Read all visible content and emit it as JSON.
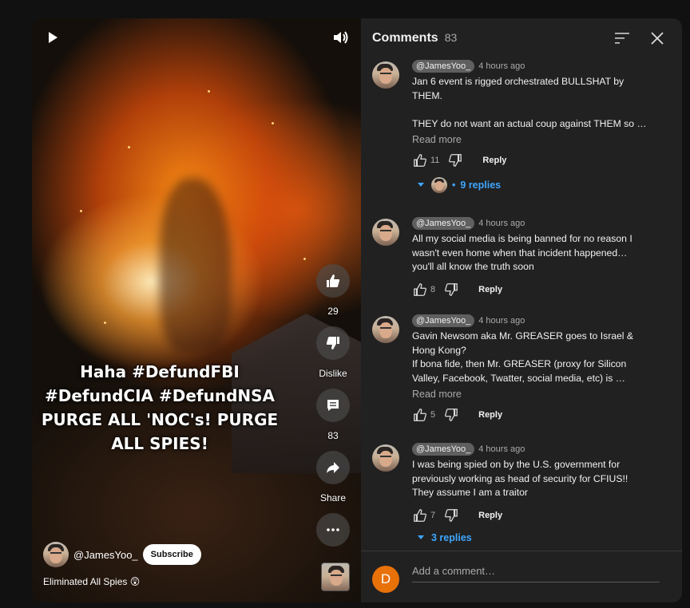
{
  "video": {
    "overlay_text": "Haha #DefundFBI #DefundCIA #DefundNSA PURGE ALL 'NOC's! PURGE ALL SPIES!",
    "channel_name": "@JamesYoo_",
    "subscribe_label": "Subscribe",
    "caption": "Eliminated All Spies 😲",
    "actions": {
      "like_count": "29",
      "dislike_label": "Dislike",
      "comments_count": "83",
      "share_label": "Share"
    },
    "icons": [
      "play-icon",
      "volume-icon",
      "thumb-up-icon",
      "thumb-down-icon",
      "comment-icon",
      "share-icon",
      "more-icon"
    ]
  },
  "comments_panel": {
    "title": "Comments",
    "count": "83",
    "comments": [
      {
        "handle": "@JamesYoo_",
        "time": "4 hours ago",
        "text": "Jan 6 event is rigged orchestrated BULLSHAT by THEM.\n\nTHEY do not want an actual coup against THEM so …",
        "read_more": "Read more",
        "likes": "11",
        "reply_label": "Reply",
        "replies": "9 replies"
      },
      {
        "handle": "@JamesYoo_",
        "time": "4 hours ago",
        "text": "All my social media is being banned for no reason I wasn't even home when that incident happened… you'll all know the truth soon",
        "likes": "8",
        "reply_label": "Reply"
      },
      {
        "handle": "@JamesYoo_",
        "time": "4 hours ago",
        "text": "Gavin Newsom aka Mr. GREASER goes to Israel & Hong Kong?\nIf bona fide, then Mr. GREASER (proxy for Silicon Valley, Facebook, Twatter, social media, etc) is …",
        "read_more": "Read more",
        "likes": "5",
        "reply_label": "Reply"
      },
      {
        "handle": "@JamesYoo_",
        "time": "4 hours ago",
        "text": "I was being spied on by the U.S. government for previously working as head of security for CFIUS!! They assume I am a traitor",
        "likes": "7",
        "reply_label": "Reply",
        "replies": "3 replies"
      }
    ],
    "add_comment_placeholder": "Add a comment…",
    "user_initial": "D",
    "colors": {
      "panel_bg": "#212121",
      "link_blue": "#3ea6ff",
      "user_avatar": "#e8710a"
    }
  }
}
